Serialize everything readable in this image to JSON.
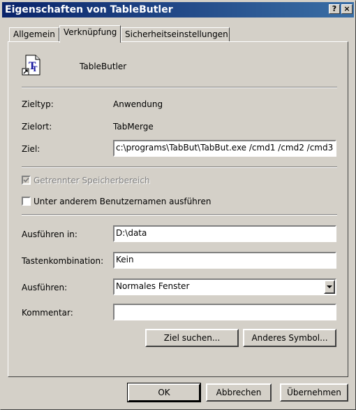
{
  "window": {
    "title": "Eigenschaften von TableButler",
    "help_label": "?",
    "close_label": "×"
  },
  "tabs": [
    {
      "label": "Allgemein"
    },
    {
      "label": "Verknüpfung"
    },
    {
      "label": "Sicherheitseinstellungen"
    }
  ],
  "shortcut": {
    "name": "TableButler",
    "icon": "tablebutler-shortcut-icon",
    "zieltyp_label": "Zieltyp:",
    "zieltyp_value": "Anwendung",
    "zielort_label": "Zielort:",
    "zielort_value": "TabMerge",
    "ziel_label": "Ziel:",
    "ziel_value": "c:\\programs\\TabBut\\TabBut.exe /cmd1 /cmd2 /cmd3",
    "separate_memory_label": "Getrennter Speicherbereich",
    "separate_memory_checked": true,
    "run_as_label": "Unter anderem Benutzernamen ausführen",
    "run_as_checked": false,
    "start_in_label": "Ausführen in:",
    "start_in_value": "D:\\data",
    "hotkey_label": "Tastenkombination:",
    "hotkey_value": "Kein",
    "run_label": "Ausführen:",
    "run_value": "Normales Fenster",
    "comment_label": "Kommentar:",
    "comment_value": "",
    "find_target_label": "Ziel suchen...",
    "change_icon_label": "Anderes Symbol..."
  },
  "footer": {
    "ok_label": "OK",
    "cancel_label": "Abbrechen",
    "apply_label": "Übernehmen"
  }
}
